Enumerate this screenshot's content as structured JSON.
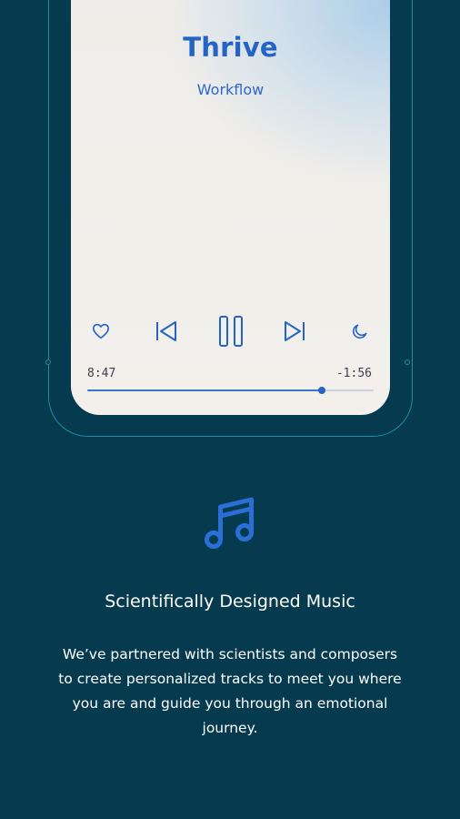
{
  "player": {
    "title": "Thrive",
    "subtitle": "Workflow",
    "elapsed": "8:47",
    "remaining": "-1:56",
    "progress_fraction": 0.82,
    "controls": [
      "heart-icon",
      "skip-back-icon",
      "pause-icon",
      "skip-forward-icon",
      "moon-icon"
    ]
  },
  "feature": {
    "icon": "music-note-icon",
    "headline": "Scientifically Designed Music",
    "description": "We’ve partnered with scientists and composers to create personalized tracks to meet you where you are and guide you through an emotional journey."
  },
  "colors": {
    "background": "#063a4f",
    "accent": "#2563c4",
    "outline": "#1b8ea6"
  }
}
